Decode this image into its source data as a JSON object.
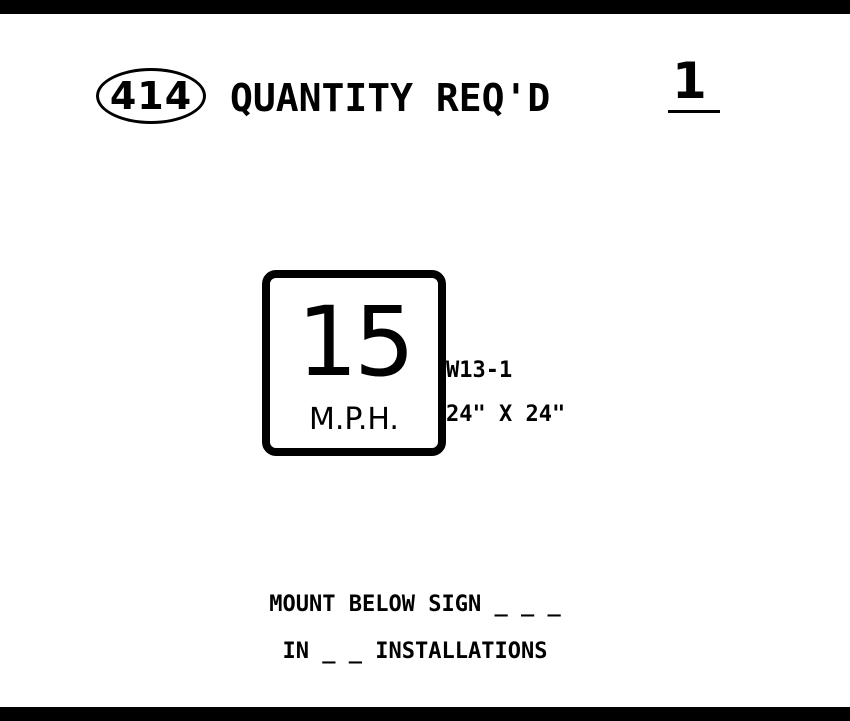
{
  "header": {
    "sheet_number": "414",
    "quantity_label": "QUANTITY REQ'D",
    "quantity_value": "1"
  },
  "sign": {
    "speed": "15",
    "unit": "M.P.H.",
    "code": "W13-1",
    "size": "24\" X 24\""
  },
  "notes": {
    "mount": "MOUNT BELOW SIGN _ _ _",
    "installations": "IN _ _ INSTALLATIONS"
  }
}
